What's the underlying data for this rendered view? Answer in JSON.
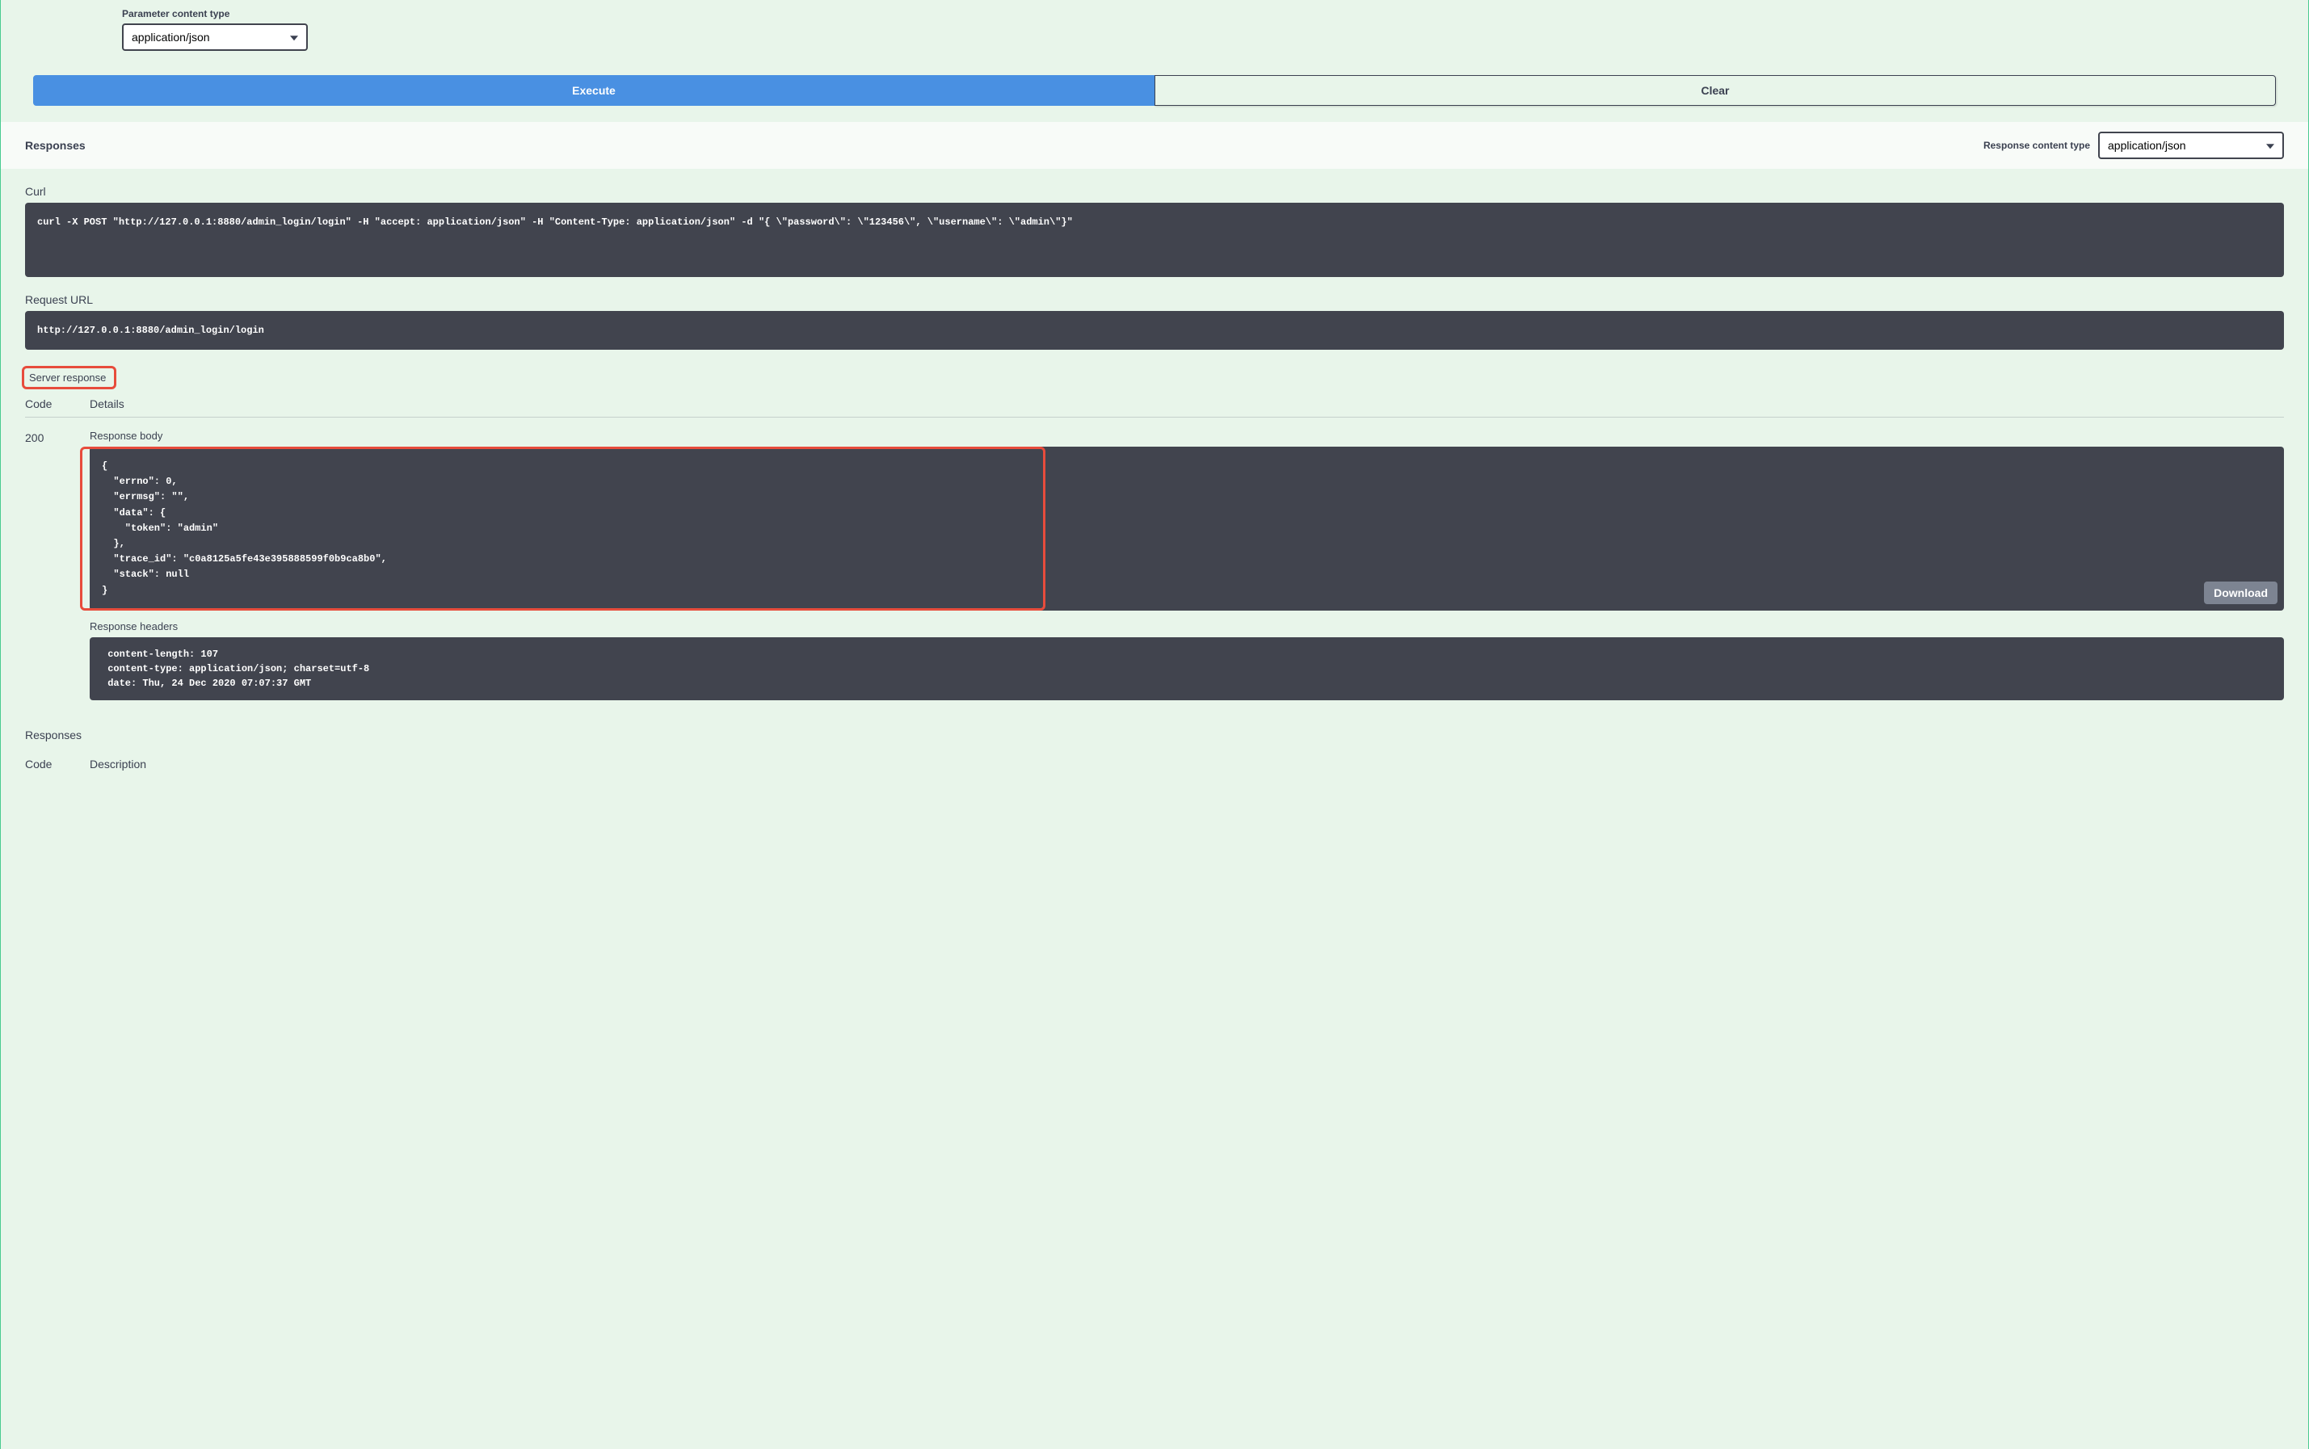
{
  "parameter": {
    "label": "Parameter content type",
    "value": "application/json"
  },
  "buttons": {
    "execute": "Execute",
    "clear": "Clear"
  },
  "responses": {
    "title": "Responses",
    "content_type_label": "Response content type",
    "content_type_value": "application/json"
  },
  "curl": {
    "label": "Curl",
    "command": "curl -X POST \"http://127.0.0.1:8880/admin_login/login\" -H \"accept: application/json\" -H \"Content-Type: application/json\" -d \"{ \\\"password\\\": \\\"123456\\\", \\\"username\\\": \\\"admin\\\"}\""
  },
  "request_url": {
    "label": "Request URL",
    "value": "http://127.0.0.1:8880/admin_login/login"
  },
  "server_response": {
    "label": "Server response",
    "code_header": "Code",
    "details_header": "Details",
    "status_code": "200",
    "body_label": "Response body",
    "body": "{\n  \"errno\": 0,\n  \"errmsg\": \"\",\n  \"data\": {\n    \"token\": \"admin\"\n  },\n  \"trace_id\": \"c0a8125a5fe43e395888599f0b9ca8b0\",\n  \"stack\": null\n}",
    "download": "Download",
    "headers_label": "Response headers",
    "headers": " content-length: 107 \n content-type: application/json; charset=utf-8 \n date: Thu, 24 Dec 2020 07:07:37 GMT "
  },
  "bottom": {
    "title": "Responses",
    "code_header": "Code",
    "description_header": "Description"
  }
}
